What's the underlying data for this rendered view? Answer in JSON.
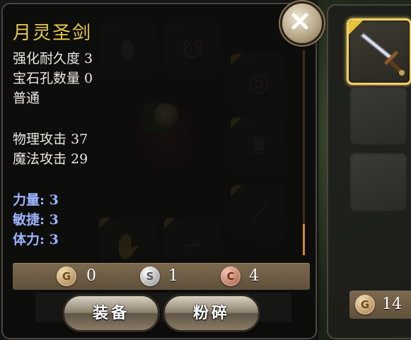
{
  "item": {
    "name": "月灵圣剑",
    "stats_basic": [
      "强化耐久度 3",
      "宝石孔数量 0",
      "普通"
    ],
    "stats_attack": [
      "物理攻击 37",
      "魔法攻击 29"
    ],
    "attributes": [
      "力量: 3",
      "敏捷: 3",
      "体力: 3"
    ]
  },
  "currency": {
    "gold": {
      "symbol": "G",
      "value": "0"
    },
    "silver": {
      "symbol": "S",
      "value": "1"
    },
    "copper": {
      "symbol": "C",
      "value": "4"
    }
  },
  "buttons": {
    "equip": "装备",
    "smash": "粉碎"
  },
  "inventory": {
    "gold_symbol": "G",
    "gold_amount": "14"
  },
  "colors": {
    "title": "#e6c94e",
    "attribute": "#9db4ff",
    "selected_border": "#f0d066",
    "rarity_corner": "#e8c23a"
  },
  "icons": [
    "close-icon",
    "sword-icon",
    "necklace-icon",
    "ring-icon",
    "armor-icon",
    "glove-icon",
    "boot-icon",
    "helmet-icon"
  ]
}
